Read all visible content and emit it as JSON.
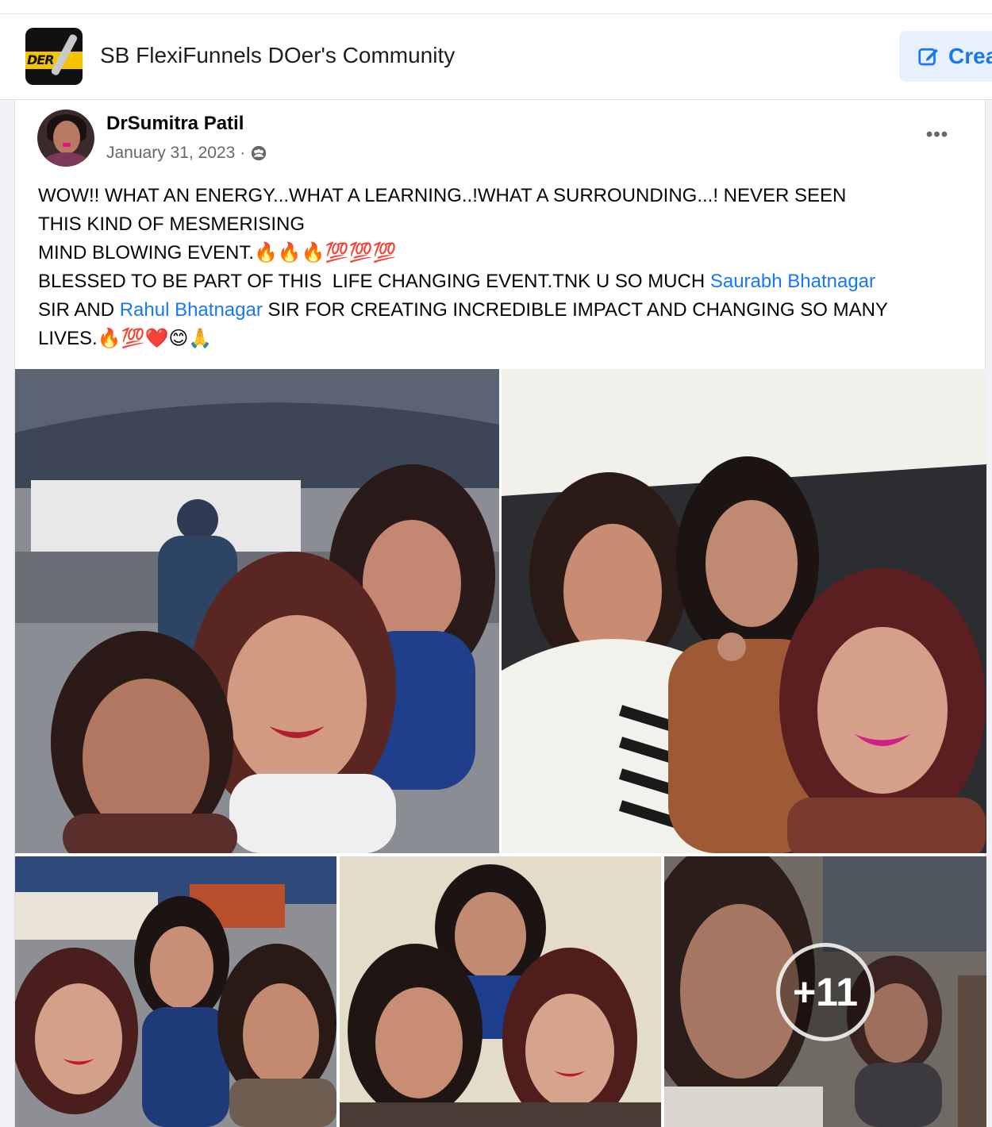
{
  "group": {
    "name": "SB FlexiFunnels DOer's Community",
    "logo_text": "DER",
    "create_label": "Crea"
  },
  "post": {
    "author": "DrSumitra Patil",
    "date": "January 31, 2023",
    "separator": "·",
    "audience_icon": "group-audience-icon",
    "more_label": "•••",
    "text_lines": [
      "WOW!! WHAT AN ENERGY...WHAT A LEARNING..!WHAT A SURROUNDING...! NEVER SEEN",
      "THIS KIND OF MESMERISING",
      "MIND BLOWING EVENT.🔥🔥🔥💯💯💯",
      "BLESSED TO BE PART OF THIS  LIFE CHANGING EVENT.TNK U SO MUCH ",
      " SIR AND ",
      " SIR FOR CREATING INCREDIBLE IMPACT AND CHANGING SO MANY",
      "LIVES.🔥💯❤️😊🙏"
    ],
    "mentions": [
      "Saurabh Bhatnagar",
      "Rahul Bhatnagar"
    ],
    "photos": [
      {
        "subject": "selfie-group-of-three-in-stadium"
      },
      {
        "subject": "selfie-group-of-three-indoor"
      },
      {
        "subject": "selfie-group-of-three-expo"
      },
      {
        "subject": "selfie-group-of-three-wall"
      },
      {
        "subject": "video-thumbnail",
        "more_count": "+11"
      }
    ]
  },
  "colors": {
    "link": "#1877f2",
    "create_bg": "#e7f0fc",
    "meta_text": "#65676b"
  }
}
